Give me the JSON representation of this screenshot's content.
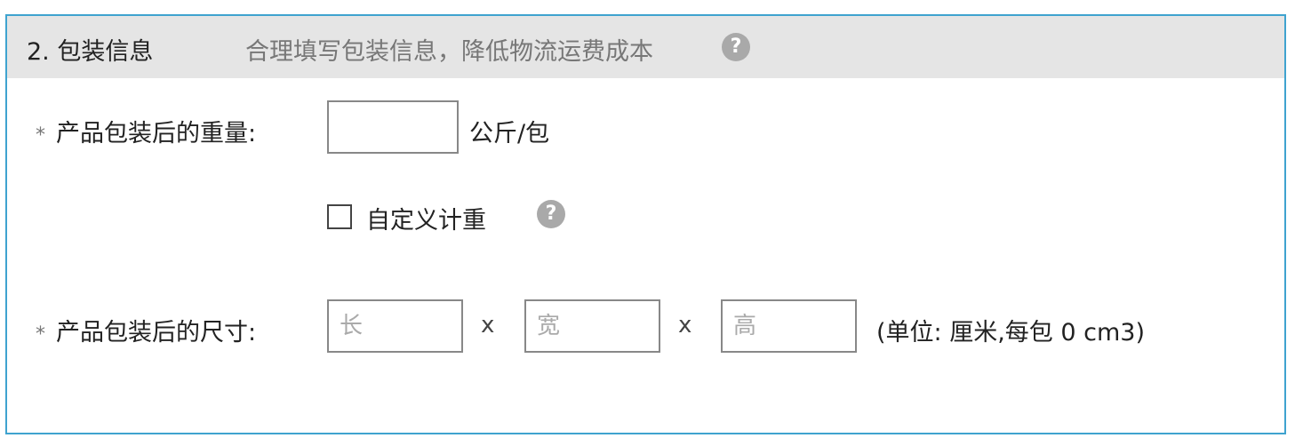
{
  "section": {
    "title": "2. 包装信息",
    "hint": "合理填写包装信息，降低物流运费成本",
    "help_icon": "question-circle-icon"
  },
  "weight": {
    "required_mark": "*",
    "label": "产品包装后的重量:",
    "value": "",
    "unit": "公斤/包"
  },
  "custom_weight": {
    "label": "自定义计重",
    "checked": false,
    "help_icon": "question-circle-icon"
  },
  "size": {
    "required_mark": "*",
    "label": "产品包装后的尺寸:",
    "length_placeholder": "长",
    "width_placeholder": "宽",
    "height_placeholder": "高",
    "separator": "x",
    "unit_text": "(单位: 厘米,每包 0 cm3)"
  },
  "colors": {
    "border_accent": "#3fa3cf",
    "header_bg": "#e5e5e5",
    "help_icon_bg": "#a9a9a9"
  }
}
